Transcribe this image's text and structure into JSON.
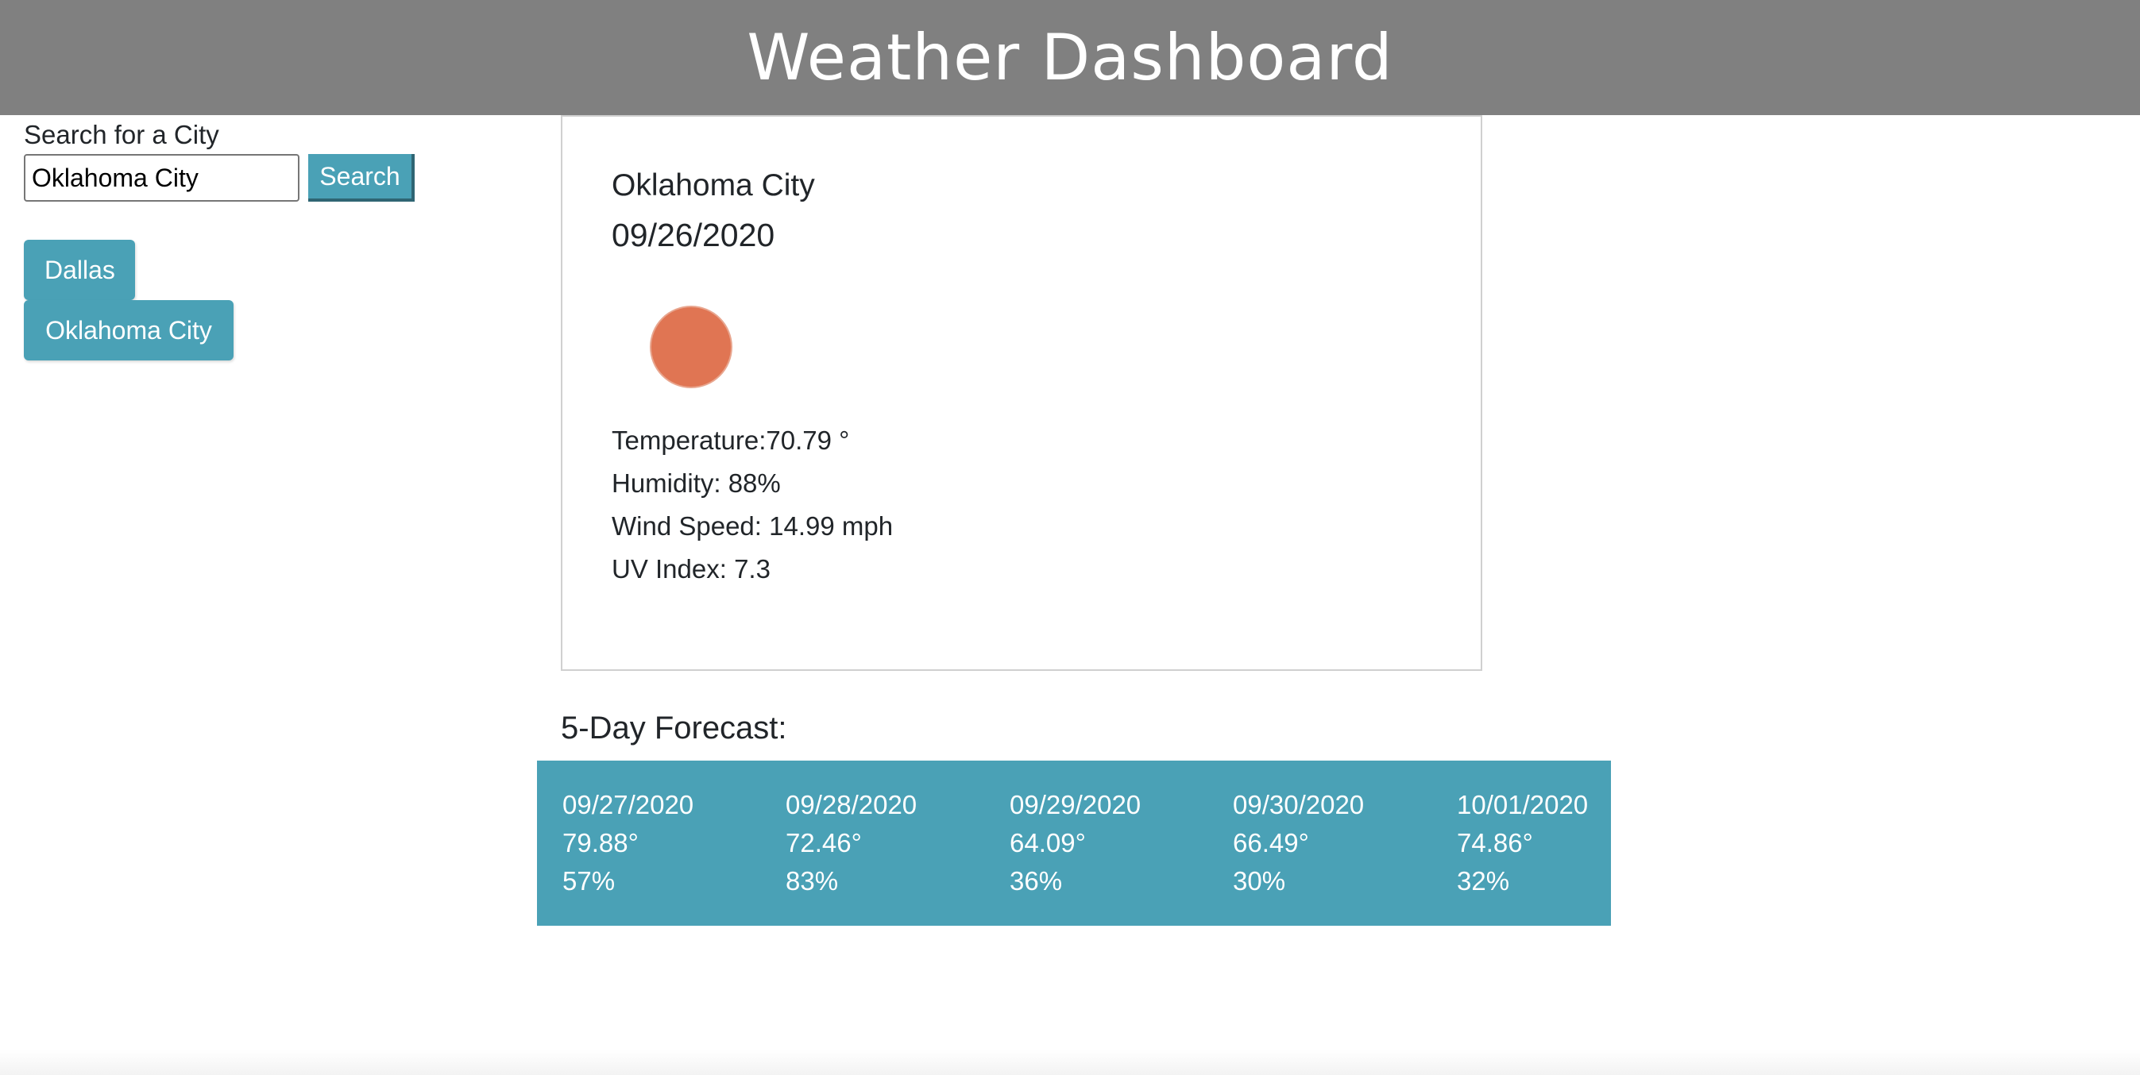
{
  "header": {
    "title": "Weather Dashboard"
  },
  "search": {
    "label": "Search for a City",
    "value": "Oklahoma City",
    "button_label": "Search"
  },
  "history": [
    "Dallas",
    "Oklahoma City"
  ],
  "current": {
    "city": "Oklahoma City",
    "date": "09/26/2020",
    "icon": "weather-icon",
    "temperature": "Temperature:70.79 °",
    "humidity": "Humidity: 88%",
    "wind_speed": "Wind Speed: 14.99 mph",
    "uv_index": "UV Index: 7.3"
  },
  "forecast": {
    "heading": "5-Day Forecast:",
    "days": [
      {
        "date": "09/27/2020",
        "temp": "79.88°",
        "humidity": "57%"
      },
      {
        "date": "09/28/2020",
        "temp": "72.46°",
        "humidity": "83%"
      },
      {
        "date": "09/29/2020",
        "temp": "64.09°",
        "humidity": "36%"
      },
      {
        "date": "09/30/2020",
        "temp": "66.49°",
        "humidity": "30%"
      },
      {
        "date": "10/01/2020",
        "temp": "74.86°",
        "humidity": "32%"
      }
    ]
  },
  "colors": {
    "header_bg": "#808080",
    "accent": "#4aa1b6",
    "icon_color": "#e07553"
  }
}
